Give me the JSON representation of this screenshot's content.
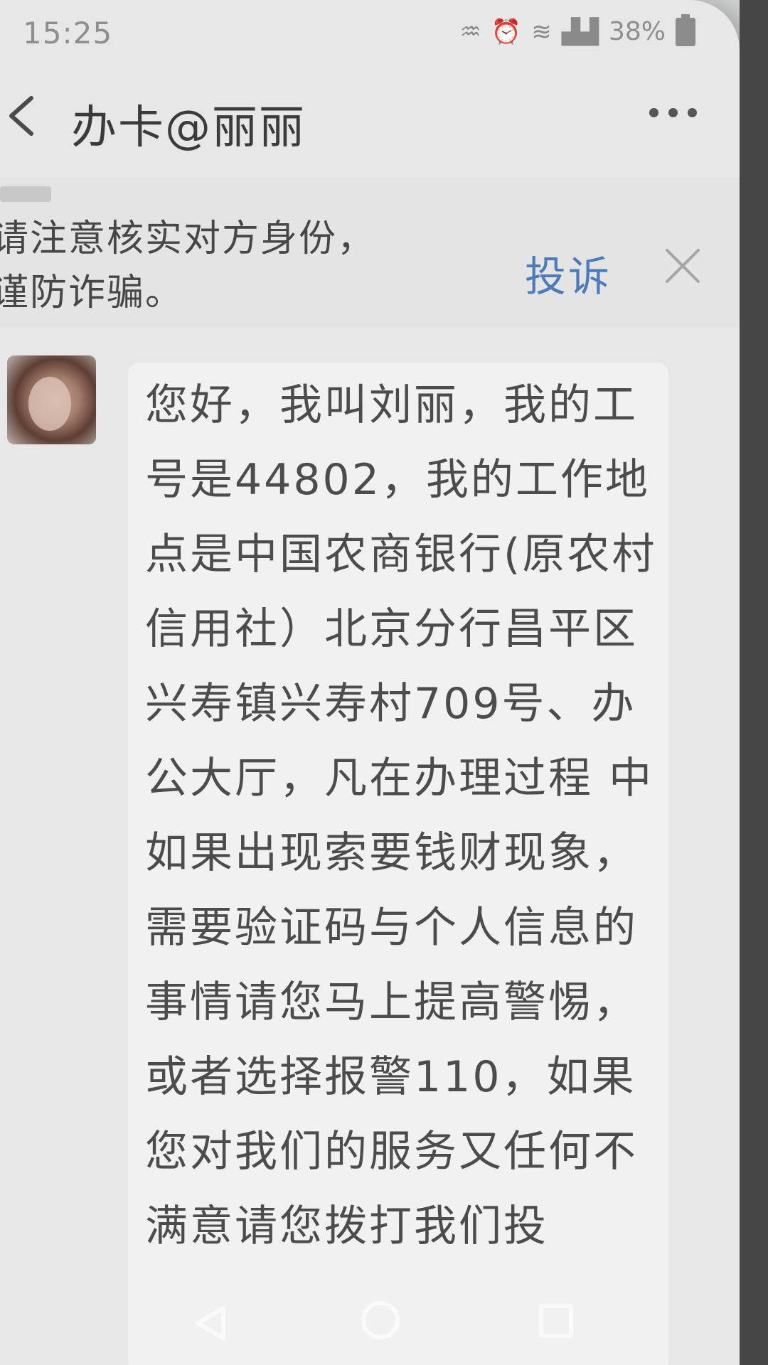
{
  "status_bar": {
    "time": "15:25",
    "battery": "38%"
  },
  "header": {
    "title": "办卡@丽丽"
  },
  "warning": {
    "line1": "请注意核实对方身份，",
    "line2": "谨防诈骗。",
    "complain_label": "投诉"
  },
  "message": {
    "text": "您好，我叫刘丽，我的工号是44802，我的工作地点是中国农商银行(原农村信用社）北京分行昌平区兴寿镇兴寿村709号、办公大厅，凡在办理过程 中如果出现索要钱财现象，需要验证码与个人信息的事情请您马上提高警惕，或者选择报警110，如果您对我们的服务又任何不满意请您拨打我们投"
  },
  "colors": {
    "link": "#4d7ab8",
    "background": "#e7e7e7",
    "bubble": "#f1f1f1"
  }
}
